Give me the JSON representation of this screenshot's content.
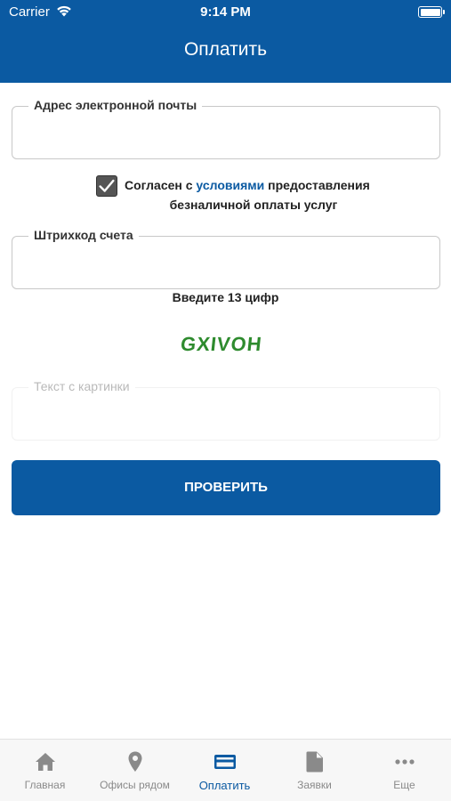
{
  "status_bar": {
    "carrier": "Carrier",
    "time": "9:14 PM"
  },
  "header": {
    "title": "Оплатить"
  },
  "email_field": {
    "label": "Адрес электронной почты",
    "value": ""
  },
  "agreement": {
    "checked": true,
    "prefix": "Согласен с ",
    "link_text": "условиями",
    "suffix": " предоставления",
    "line2": "безналичной оплаты услуг"
  },
  "barcode_field": {
    "label": "Штрихкод счета",
    "value": ""
  },
  "barcode_hint": "Введите 13 цифр",
  "captcha": {
    "text": "GXIVOH",
    "color": "#2e8b2e"
  },
  "captcha_field": {
    "label": "Текст с картинки",
    "value": ""
  },
  "verify_button": {
    "label": "ПРОВЕРИТЬ"
  },
  "colors": {
    "primary": "#0b5aa2",
    "tab_inactive": "#8a8a8a"
  },
  "tabs": [
    {
      "label": "Главная",
      "icon": "home-icon",
      "active": false
    },
    {
      "label": "Офисы рядом",
      "icon": "location-pin-icon",
      "active": false
    },
    {
      "label": "Оплатить",
      "icon": "credit-card-icon",
      "active": true
    },
    {
      "label": "Заявки",
      "icon": "document-icon",
      "active": false
    },
    {
      "label": "Еще",
      "icon": "more-icon",
      "active": false
    }
  ]
}
